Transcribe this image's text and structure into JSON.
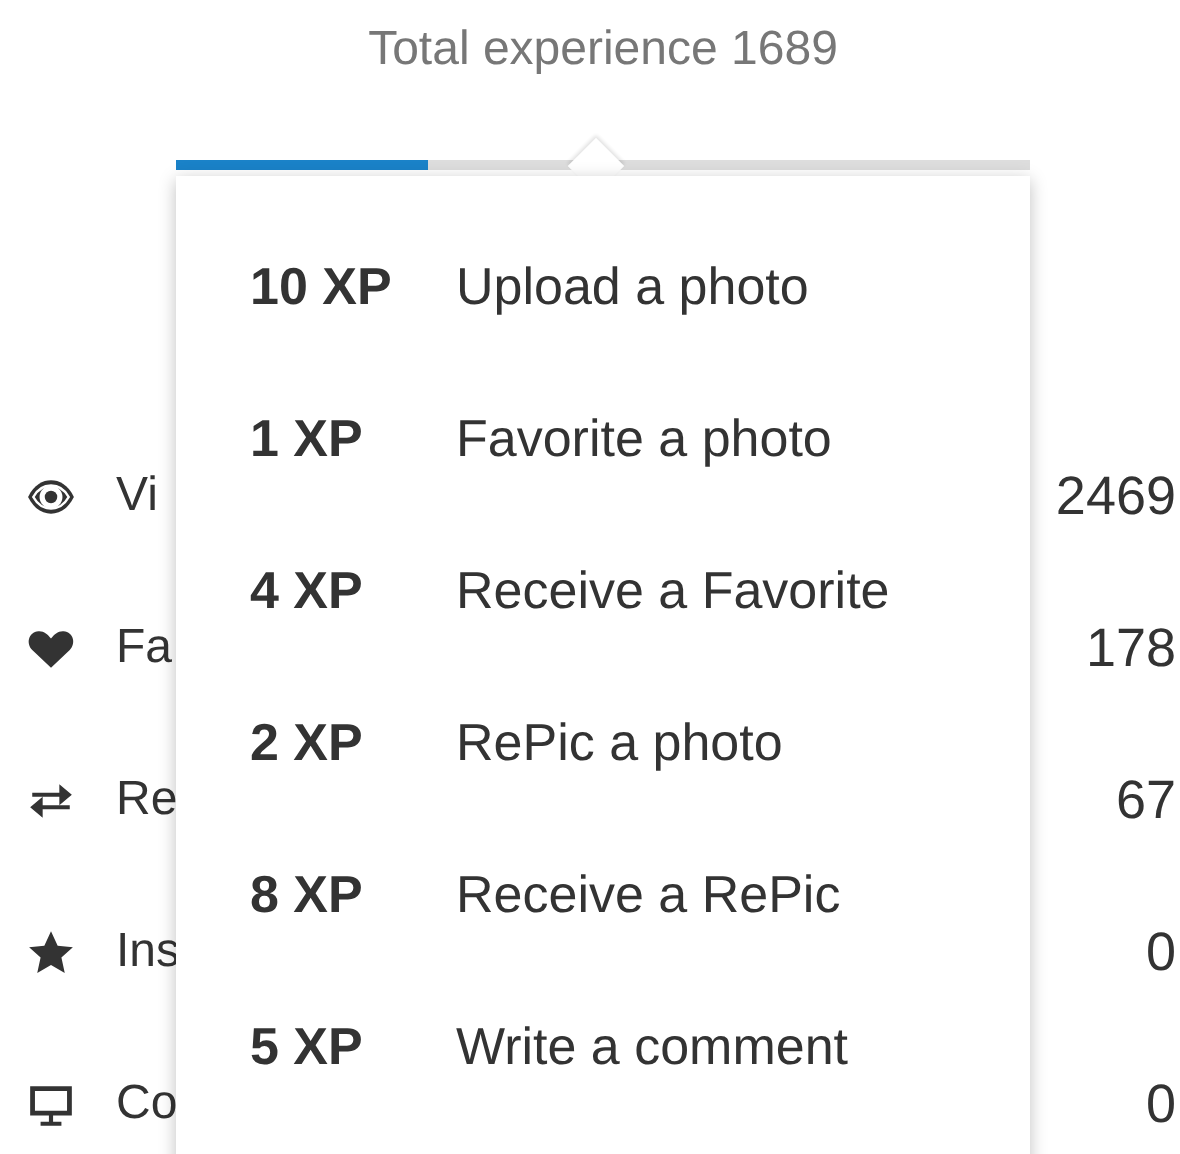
{
  "title": "Total experience 1689",
  "progress": {
    "level": 0.295
  },
  "stats": [
    {
      "kind": "eye",
      "label": "Vi",
      "value": "2469"
    },
    {
      "kind": "heart",
      "label": "Fa",
      "value": "178"
    },
    {
      "kind": "repeat",
      "label": "Re",
      "value": "67"
    },
    {
      "kind": "star",
      "label": "Ins",
      "value": "0"
    },
    {
      "kind": "monitor",
      "label": "Co",
      "value": "0"
    }
  ],
  "popover": {
    "items": [
      {
        "xp": "10 XP",
        "action": "Upload a photo"
      },
      {
        "xp": "1 XP",
        "action": "Favorite a photo"
      },
      {
        "xp": "4 XP",
        "action": "Receive a Favorite"
      },
      {
        "xp": "2 XP",
        "action": "RePic a photo"
      },
      {
        "xp": "8 XP",
        "action": "Receive a RePic"
      },
      {
        "xp": "5 XP",
        "action": "Write a comment"
      }
    ]
  }
}
